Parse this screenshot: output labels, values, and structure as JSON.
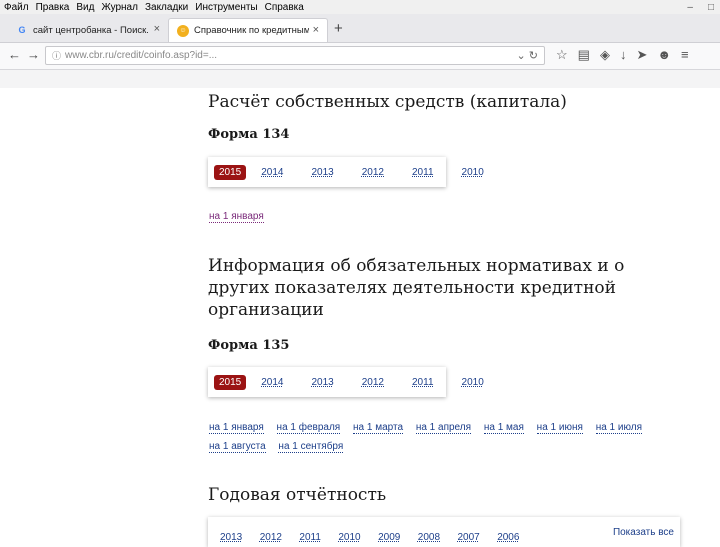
{
  "browser": {
    "menu": [
      "Файл",
      "Правка",
      "Вид",
      "Журнал",
      "Закладки",
      "Инструменты",
      "Справка"
    ],
    "tabs": [
      {
        "title": "сайт центробанка - Поиск..."
      },
      {
        "title": "Справочник по кредитным..."
      }
    ],
    "url": "www.cbr.ru/credit/coinfo.asp?id=...",
    "tab_icons": [
      "google-icon",
      "cbr-favicon"
    ]
  },
  "page": {
    "section1": {
      "title": "Расчёт собственных средств (капитала)",
      "form": "Форма 134",
      "years": [
        "2015",
        "2014",
        "2013",
        "2012",
        "2011",
        "2010"
      ],
      "active_year": "2015",
      "dates": [
        "на 1 января"
      ]
    },
    "section2": {
      "title_lines": [
        "Информация об обязательных нормативах и о",
        "других показателях деятельности кредитной",
        "организации"
      ],
      "form": "Форма 135",
      "years": [
        "2015",
        "2014",
        "2013",
        "2012",
        "2011",
        "2010"
      ],
      "active_year": "2015",
      "dates_row1": [
        "на 1 января",
        "на 1 февраля",
        "на 1 марта",
        "на 1 апреля",
        "на 1 мая",
        "на 1 июня",
        "на 1 июля"
      ],
      "dates_row2": [
        "на 1 августа",
        "на 1 сентября"
      ]
    },
    "section3": {
      "title": "Годовая отчётность",
      "years": [
        "2013",
        "2012",
        "2011",
        "2010",
        "2009",
        "2008",
        "2007",
        "2006"
      ],
      "show_all": "Показать все"
    }
  },
  "colors": {
    "accent": "#9b1313",
    "link": "#1d3f8a",
    "visited": "#7a2a7a"
  }
}
